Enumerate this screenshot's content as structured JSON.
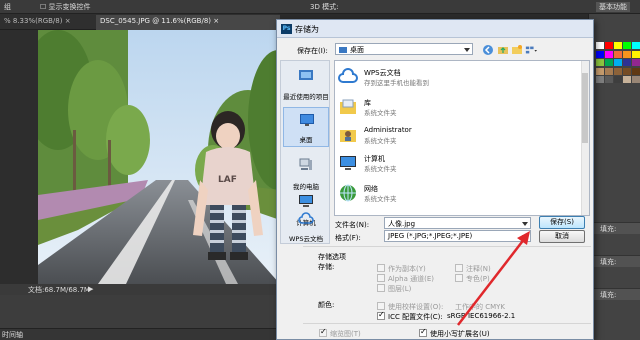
{
  "optionbar": {
    "mode_label": "组",
    "show_transform_label": "显示变换控件",
    "mode3d_label": "3D 模式:",
    "workspace_label": "基本功能"
  },
  "tabs": [
    {
      "label": "% 8.33%(RGB/8) × "
    },
    {
      "label": "DSC_0545.JPG @ 11.6%(RGB/8) × "
    }
  ],
  "status": {
    "doc_size": "文档:68.7M/68.7M",
    "timeline": "时间轴"
  },
  "right_panel": {
    "labels": [
      "填充:",
      "填充:",
      "填充:"
    ]
  },
  "dialog": {
    "title": "存储为",
    "save_in_label": "保存在(I):",
    "save_in_value": "桌面",
    "places": [
      {
        "label": "最近使用的项目"
      },
      {
        "label": "桌面"
      },
      {
        "label": "我的电脑"
      },
      {
        "label": "计算机"
      },
      {
        "label": "WPS云文档"
      }
    ],
    "files": [
      {
        "name": "WPS云文档",
        "desc": "存到这里手机也能看到"
      },
      {
        "name": "库",
        "desc": "系统文件夹"
      },
      {
        "name": "Administrator",
        "desc": "系统文件夹"
      },
      {
        "name": "计算机",
        "desc": "系统文件夹"
      },
      {
        "name": "网络",
        "desc": "系统文件夹"
      }
    ],
    "filename_label": "文件名(N):",
    "filename_value": "人像.jpg",
    "format_label": "格式(F):",
    "format_value": "JPEG (*.JPG;*.JPEG;*.JPE)",
    "save_button": "保存(S)",
    "cancel_button": "取消",
    "options_title": "存储选项",
    "storage_label": "存储:",
    "opt_as_copy": "作为副本(Y)",
    "opt_notes": "注释(N)",
    "opt_alpha": "Alpha 通道(E)",
    "opt_spot": "专色(P)",
    "opt_layers": "图层(L)",
    "color_label": "颜色:",
    "opt_proof": "使用校样设置(O):",
    "opt_proof_suffix": "工作中的 CMYK",
    "opt_icc": "ICC 配置文件(C):",
    "opt_icc_value": "sRGB IEC61966-2.1",
    "opt_thumb": "缩览图(T)",
    "opt_lowercase": "使用小写扩展名(U)"
  },
  "colors": {
    "arrow": "#e0282c",
    "swatches": [
      "#ffffff",
      "#ff0000",
      "#ffff00",
      "#00ff00",
      "#00ffff",
      "#0000ff",
      "#ff00ff",
      "#f26b3a",
      "#f7941d",
      "#fff200",
      "#8dc63f",
      "#00a651",
      "#00aeef",
      "#2e3192",
      "#92278f",
      "#c69c6d",
      "#a67c52",
      "#8c6239",
      "#754c24",
      "#603913",
      "#7f7f7f",
      "#5a5a5a",
      "#3e3e3e",
      "#c7b299",
      "#998675"
    ]
  }
}
